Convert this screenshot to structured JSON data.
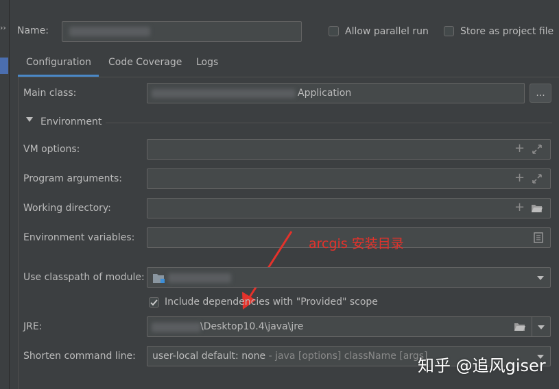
{
  "header": {
    "name_label": "Name:",
    "allow_parallel_label": "Allow parallel run",
    "store_as_file_label": "Store as project file",
    "chevron_glyph": "››"
  },
  "tabs": [
    {
      "label": "Configuration",
      "active": true
    },
    {
      "label": "Code Coverage",
      "active": false
    },
    {
      "label": "Logs",
      "active": false
    }
  ],
  "main_class": {
    "label": "Main class:",
    "value_suffix": "Application",
    "browse_label": "..."
  },
  "environment": {
    "section_label": "Environment",
    "vm_options_label": "VM options:",
    "program_args_label": "Program arguments:",
    "working_dir_label": "Working directory:",
    "env_vars_label": "Environment variables:"
  },
  "classpath": {
    "label": "Use classpath of module:",
    "include_deps_label": "Include dependencies with \"Provided\" scope",
    "include_deps_checked": true
  },
  "jre": {
    "label": "JRE:",
    "value_suffix": "\\Desktop10.4\\java\\jre"
  },
  "shorten": {
    "label": "Shorten command line:",
    "value": "user-local default: none",
    "hint": " - java [options] className [args]"
  },
  "annotation": {
    "text": "arcgis 安装目录",
    "color": "#e4322b"
  },
  "watermark": {
    "text": "知乎 @追风giser"
  },
  "colors": {
    "background": "#3c3f41",
    "field": "#45494a",
    "accent": "#4a88c7",
    "selection": "#4b6eaf"
  }
}
